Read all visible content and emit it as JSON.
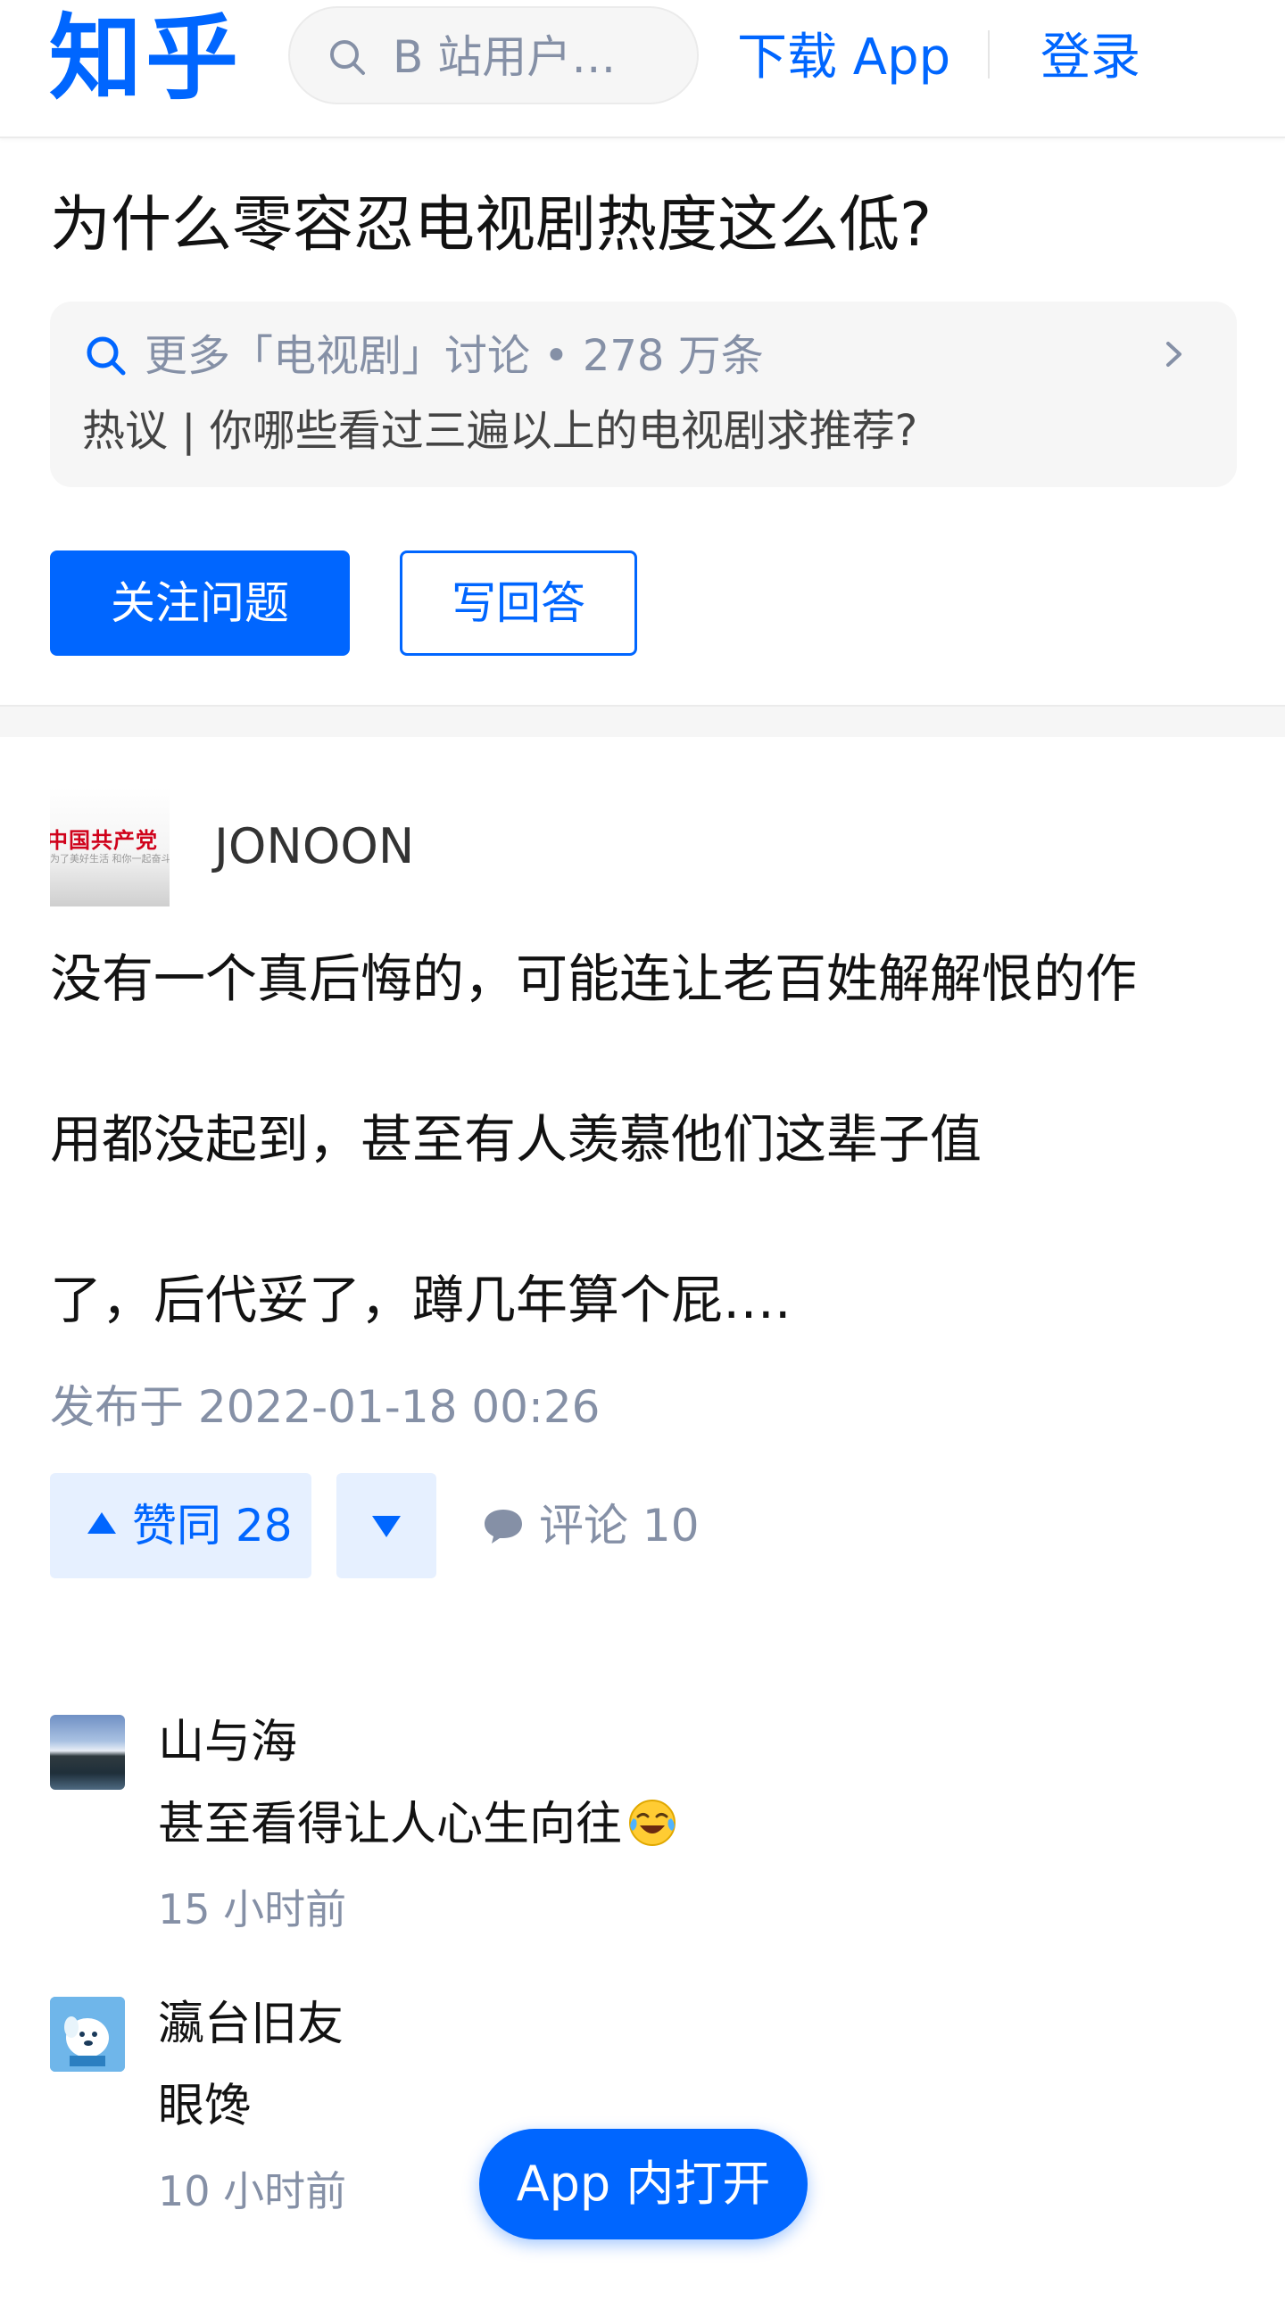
{
  "header": {
    "logo": "知乎",
    "search_placeholder": "B 站用户…",
    "download": "下载 App",
    "login": "登录"
  },
  "question": {
    "title": "为什么零容忍电视剧热度这么低?",
    "topic_more": "更多「电视剧」讨论 • 278 万条",
    "topic_hot": "热议 | 你哪些看过三遍以上的电视剧求推荐?",
    "follow_label": "关注问题",
    "answer_label": "写回答"
  },
  "answer": {
    "author": "JONOON",
    "avatar_text_main": "中国共产党",
    "avatar_text_sub": "为了美好生活 和你一起奋斗",
    "lines": [
      "没有一个真后悔的，可能连让老百姓解解恨的作",
      "用都没起到，甚至有人羡慕他们这辈子值",
      "了，后代妥了，蹲几年算个屁….",
      ""
    ],
    "published": "发布于 2022-01-18 00:26",
    "upvote_label": "赞同 28",
    "comment_label": "评论 10"
  },
  "comments": [
    {
      "name": "山与海",
      "text": "甚至看得让人心生向往",
      "time": "15 小时前"
    },
    {
      "name": "瀛台旧友",
      "text": "眼馋",
      "time": "10 小时前"
    }
  ],
  "floating": {
    "open_app": "App 内打开"
  },
  "colors": {
    "brand": "#0066ff",
    "muted": "#8590a6",
    "bg_gray": "#f6f6f6"
  }
}
